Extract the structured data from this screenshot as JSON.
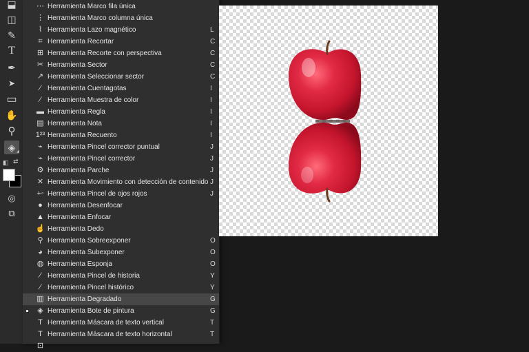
{
  "toolbar": {
    "tools": [
      {
        "name": "stamp-tool-icon",
        "glyph": "⬓"
      },
      {
        "name": "eraser-tool-icon",
        "glyph": "◫"
      },
      {
        "name": "paint-bucket-small-icon",
        "glyph": "✎"
      },
      {
        "name": "type-tool-icon",
        "glyph": "T"
      },
      {
        "name": "pen-tool-icon",
        "glyph": "✒"
      },
      {
        "name": "path-selection-tool-icon",
        "glyph": "➤"
      },
      {
        "name": "rectangle-tool-icon",
        "glyph": "▭"
      },
      {
        "name": "hand-tool-icon",
        "glyph": "✋"
      },
      {
        "name": "zoom-tool-icon",
        "glyph": "⚲"
      },
      {
        "name": "paint-bucket-tool-icon",
        "glyph": "◈"
      }
    ],
    "swap_glyph": "⇄",
    "default_colors_glyph": "◧",
    "quick_mask_glyph": "◎",
    "screen_mode_glyph": "⧉",
    "foreground_color": "#ffffff",
    "background_color": "#000000"
  },
  "menu": {
    "items": [
      {
        "label": "Herramienta Marco fila única",
        "key": "",
        "icon": "⋯"
      },
      {
        "label": "Herramienta Marco columna única",
        "key": "",
        "icon": "⋮"
      },
      {
        "label": "Herramienta Lazo magnético",
        "key": "L",
        "icon": "⌇"
      },
      {
        "label": "Herramienta Recortar",
        "key": "C",
        "icon": "⌗"
      },
      {
        "label": "Herramienta Recorte con perspectiva",
        "key": "C",
        "icon": "⊞"
      },
      {
        "label": "Herramienta Sector",
        "key": "C",
        "icon": "✂"
      },
      {
        "label": "Herramienta Seleccionar sector",
        "key": "C",
        "icon": "↗"
      },
      {
        "label": "Herramienta Cuentagotas",
        "key": "I",
        "icon": "⁄"
      },
      {
        "label": "Herramienta Muestra de color",
        "key": "I",
        "icon": "⁄"
      },
      {
        "label": "Herramienta Regla",
        "key": "I",
        "icon": "▬"
      },
      {
        "label": "Herramienta Nota",
        "key": "I",
        "icon": "▤"
      },
      {
        "label": "Herramienta Recuento",
        "key": "I",
        "icon": "1²³"
      },
      {
        "label": "Herramienta Pincel corrector puntual",
        "key": "J",
        "icon": "⌁"
      },
      {
        "label": "Herramienta Pincel corrector",
        "key": "J",
        "icon": "⌁"
      },
      {
        "label": "Herramienta Parche",
        "key": "J",
        "icon": "⚙"
      },
      {
        "label": "Herramienta Movimiento con detección de contenido",
        "key": "J",
        "icon": "✕"
      },
      {
        "label": "Herramienta Pincel de ojos rojos",
        "key": "J",
        "icon": "+◦"
      },
      {
        "label": "Herramienta Desenfocar",
        "key": "",
        "icon": "●"
      },
      {
        "label": "Herramienta Enfocar",
        "key": "",
        "icon": "▲"
      },
      {
        "label": "Herramienta Dedo",
        "key": "",
        "icon": "☝"
      },
      {
        "label": "Herramienta Sobreexponer",
        "key": "O",
        "icon": "⚲"
      },
      {
        "label": "Herramienta Subexponer",
        "key": "O",
        "icon": "◕"
      },
      {
        "label": "Herramienta Esponja",
        "key": "O",
        "icon": "◍"
      },
      {
        "label": "Herramienta Pincel de historia",
        "key": "Y",
        "icon": "⁄"
      },
      {
        "label": "Herramienta Pincel histórico",
        "key": "Y",
        "icon": "⁄"
      },
      {
        "label": "Herramienta Degradado",
        "key": "G",
        "icon": "▥",
        "highlighted": true
      },
      {
        "label": "Herramienta Bote de pintura",
        "key": "G",
        "icon": "◈",
        "selected": true
      },
      {
        "label": "Herramienta Máscara de texto vertical",
        "key": "T",
        "icon": "T"
      },
      {
        "label": "Herramienta Máscara de texto horizontal",
        "key": "T",
        "icon": "T"
      },
      {
        "label": "",
        "key": "",
        "icon": "⊡"
      }
    ]
  },
  "canvas": {
    "checker_color": "#d9d9d9",
    "apple_color": "#d81f3a"
  }
}
